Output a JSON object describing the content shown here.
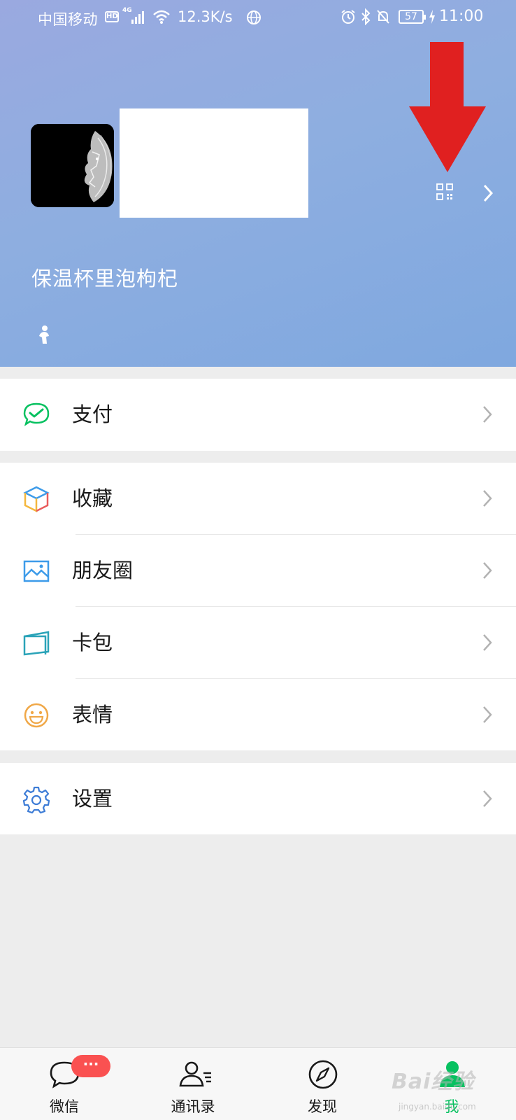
{
  "status_bar": {
    "carrier": "中国移动",
    "hd": "HD",
    "network": "4G",
    "speed": "12.3K/s",
    "battery": "57",
    "time": "11:00"
  },
  "profile": {
    "wechat_id": "保温杯里泡枸杞"
  },
  "menu": {
    "pay": {
      "label": "支付",
      "icon": "wechat-pay-icon"
    },
    "favorites": {
      "label": "收藏",
      "icon": "cube-icon"
    },
    "moments": {
      "label": "朋友圈",
      "icon": "image-icon"
    },
    "cards": {
      "label": "卡包",
      "icon": "card-icon"
    },
    "stickers": {
      "label": "表情",
      "icon": "smiley-icon"
    },
    "settings": {
      "label": "设置",
      "icon": "gear-icon"
    }
  },
  "tabbar": {
    "tabs": [
      {
        "label": "微信",
        "badge": "···"
      },
      {
        "label": "通讯录"
      },
      {
        "label": "发现"
      },
      {
        "label": "我"
      }
    ]
  },
  "watermark": {
    "text": "Bai经验",
    "sub": "jingyan.baidu.com"
  },
  "colors": {
    "accent": "#07c160",
    "badge": "#fa5151",
    "arrow": "#e02020",
    "header_bg": "#8eaee0"
  }
}
